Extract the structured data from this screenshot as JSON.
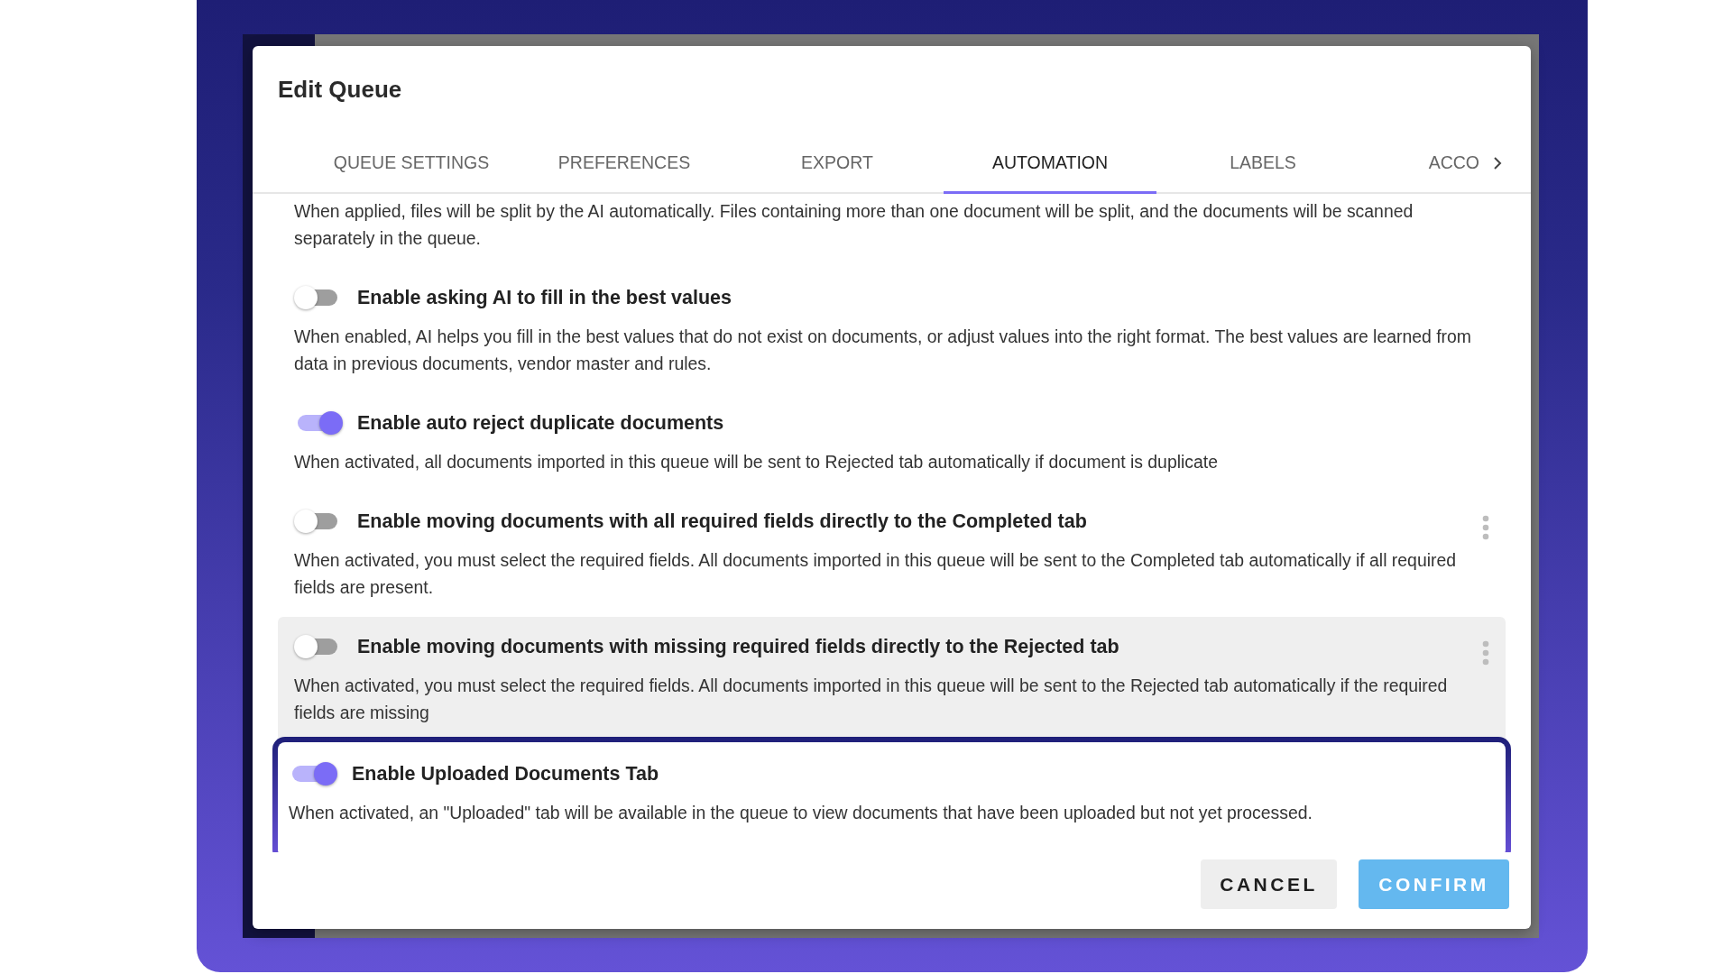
{
  "dialog": {
    "title": "Edit Queue"
  },
  "tabs": [
    {
      "label": "QUEUE SETTINGS",
      "selected": false
    },
    {
      "label": "PREFERENCES",
      "selected": false
    },
    {
      "label": "EXPORT",
      "selected": false
    },
    {
      "label": "AUTOMATION",
      "selected": true
    },
    {
      "label": "LABELS",
      "selected": false
    },
    {
      "label": "ACCO",
      "selected": false
    }
  ],
  "settings": [
    {
      "kind": "text",
      "description": "When applied, files will be split by the AI automatically. Files containing more than one document will be split, and the documents will be scanned separately in the queue.",
      "hovered": false,
      "highlighted": false
    },
    {
      "kind": "toggle",
      "title": "Enable asking AI to fill in the best values",
      "description": "When enabled, AI helps you fill in the best values that do not exist on documents, or adjust values into the right format. The best values are learned from data in previous documents, vendor master and rules.",
      "on": false,
      "menu": false,
      "hovered": false,
      "highlighted": false
    },
    {
      "kind": "toggle",
      "title": "Enable auto reject duplicate documents",
      "description": "When activated, all documents imported in this queue will be sent to Rejected tab automatically if document is duplicate",
      "on": true,
      "menu": false,
      "hovered": false,
      "highlighted": false
    },
    {
      "kind": "toggle",
      "title": "Enable moving documents with all required fields directly to the Completed tab",
      "description": "When activated, you must select the required fields. All documents imported in this queue will be sent to the Completed tab automatically if all required fields are present.",
      "on": false,
      "menu": true,
      "hovered": false,
      "highlighted": false
    },
    {
      "kind": "toggle",
      "title": "Enable moving documents with missing required fields directly to the Rejected tab",
      "description": "When activated, you must select the required fields. All documents imported in this queue will be sent to the Rejected tab automatically if the required fields are missing",
      "on": false,
      "menu": true,
      "hovered": true,
      "highlighted": false
    },
    {
      "kind": "toggle",
      "title": "Enable Uploaded Documents Tab",
      "description": "When activated, an \"Uploaded\" tab will be available in the queue to view documents that have been uploaded but not yet processed.",
      "on": true,
      "menu": false,
      "hovered": false,
      "highlighted": true
    }
  ],
  "buttons": [
    {
      "kind": "secondary",
      "label": "CANCEL"
    },
    {
      "kind": "primary",
      "label": "CONFIRM"
    }
  ]
}
